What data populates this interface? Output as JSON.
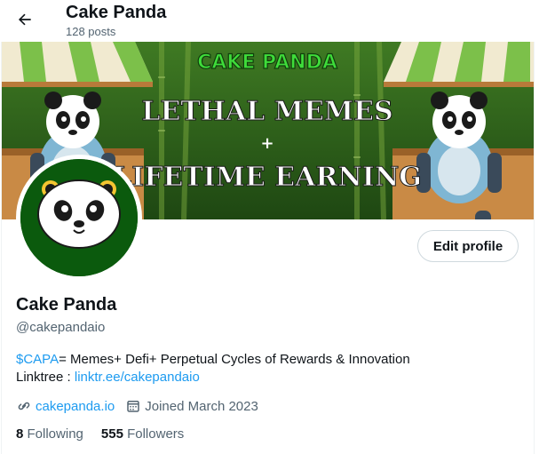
{
  "header": {
    "title": "Cake Panda",
    "post_count": "128 posts"
  },
  "banner": {
    "brand_text": "CAKE PANDA",
    "headline_1": "LETHAL MEMES",
    "plus": "+",
    "headline_2": "LIFETIME EARNING"
  },
  "profile": {
    "display_name": "Cake Panda",
    "handle": "@cakepandaio",
    "edit_button": "Edit profile",
    "bio": {
      "ticker": "$CAPA",
      "line1_rest": "= Memes+ Defi+ Perpetual Cycles of Rewards & Innovation",
      "line2_prefix": "Linktree : ",
      "line2_link": "linktr.ee/cakepandaio"
    },
    "website": "cakepanda.io",
    "joined": "Joined March 2023",
    "following_count": "8",
    "following_label": "Following",
    "followers_count": "555",
    "followers_label": "Followers"
  },
  "icons": {
    "back": "arrow-left-icon",
    "link": "link-icon",
    "calendar": "calendar-icon"
  },
  "colors": {
    "accent": "#1d9bf0",
    "text_primary": "#0f1419",
    "text_secondary": "#536471",
    "avatar_bg": "#0b5a0d",
    "banner_bg": "#2b5a1c"
  }
}
